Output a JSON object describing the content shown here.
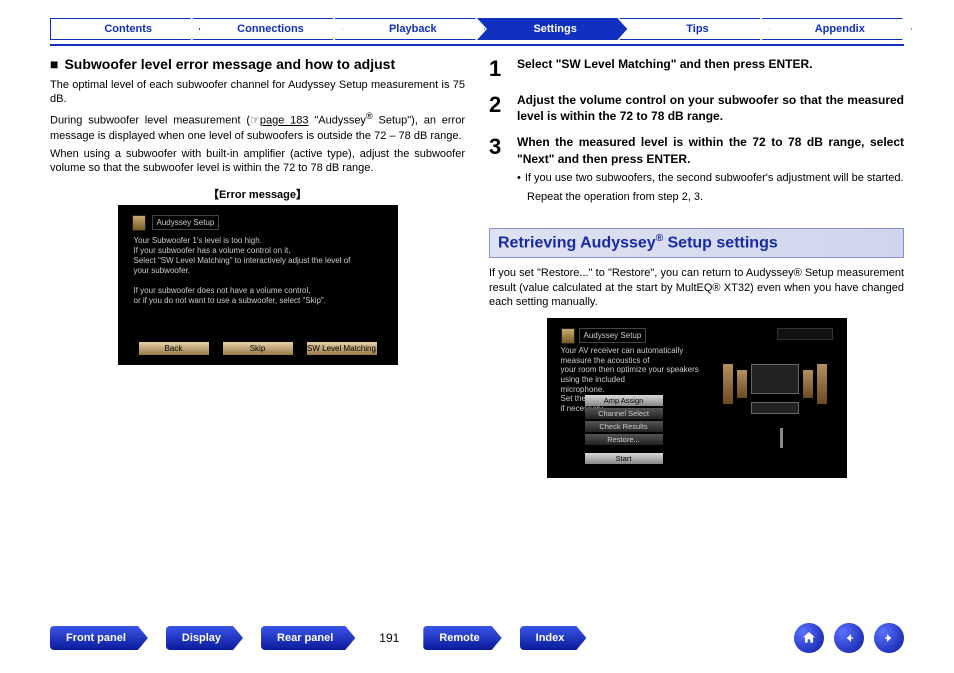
{
  "tabs": [
    "Contents",
    "Connections",
    "Playback",
    "Settings",
    "Tips",
    "Appendix"
  ],
  "activeTab": 3,
  "left": {
    "heading": "Subwoofer level error message and how to adjust",
    "p1": "The optimal level of each subwoofer channel for Audyssey Setup measurement is 75 dB.",
    "p2a": "During subwoofer level measurement (",
    "p2link": "page 183",
    "p2b": " \"Audyssey",
    "p2c": "Setup\"), an error message is displayed when one level of subwoofers is outside the 72 – 78 dB range.",
    "p3": "When using a subwoofer with built-in amplifier (active type), adjust the subwoofer volume so that the subwoofer level is within the 72 to 78 dB range.",
    "errLabel": "【Error message】",
    "shot": {
      "title": "Audyssey Setup",
      "l1": "Your Subwoofer 1's level is too high.",
      "l2": "If your subwoofer has a volume control on it,",
      "l3": "Select \"SW Level Matching\" to interactively adjust the level of",
      "l4": "your subwoofer.",
      "l5": "If your subwoofer does not have a volume control,",
      "l6": "or if you do not want to use a subwoofer, select \"Skip\".",
      "btns": [
        "Back",
        "Skip",
        "SW Level Matching"
      ]
    }
  },
  "right": {
    "steps": [
      {
        "n": "1",
        "t": "Select \"SW Level Matching\" and then press ENTER."
      },
      {
        "n": "2",
        "t": "Adjust the volume control on your subwoofer so that the measured level is within the 72 to 78 dB range."
      },
      {
        "n": "3",
        "t": "When the measured level is within the 72 to 78 dB range, select \"Next\" and then press ENTER."
      }
    ],
    "sub1": "If you use two subwoofers, the second subwoofer's adjustment will be started.",
    "sub2": "Repeat the operation from step 2, 3.",
    "sectionTitle": "Retrieving Audyssey® Setup settings",
    "sectionPara": "If you set \"Restore...\" to \"Restore\", you can return to Audyssey® Setup measurement result (value calculated at the start by MultEQ® XT32) even when you have changed each setting manually.",
    "shot2": {
      "title": "Audyssey Setup",
      "l1": "Your AV receiver can automatically measure the acoustics of",
      "l2": "your room then optimize your speakers using the included",
      "l3": "microphone.",
      "l4": "Set the following items",
      "l5": "if necessary.",
      "menu": [
        "Amp Assign",
        "Channel Select",
        "Check Results",
        "Restore..."
      ],
      "start": "Start"
    }
  },
  "bottom": {
    "pills": [
      "Front panel",
      "Display",
      "Rear panel"
    ],
    "page": "191",
    "pills2": [
      "Remote",
      "Index"
    ]
  }
}
